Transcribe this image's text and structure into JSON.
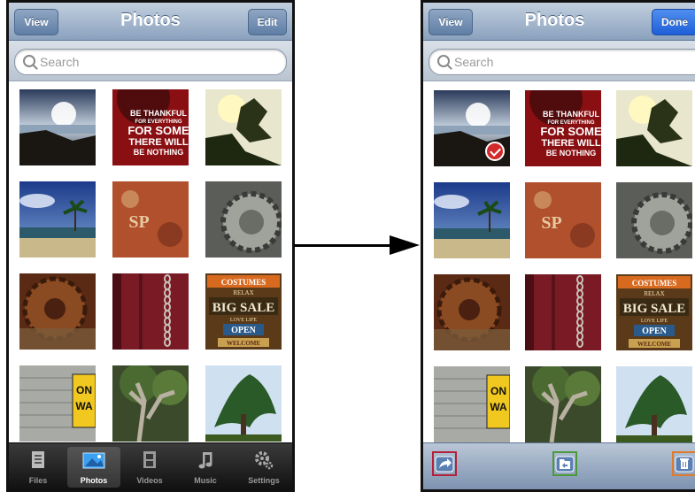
{
  "left_screen": {
    "nav": {
      "title": "Photos",
      "left_button": "View",
      "right_button": "Edit"
    },
    "search": {
      "placeholder": "Search"
    },
    "tabs": [
      {
        "label": "Files",
        "icon": "files-icon"
      },
      {
        "label": "Photos",
        "icon": "photos-icon",
        "active": true
      },
      {
        "label": "Videos",
        "icon": "film-icon"
      },
      {
        "label": "Music",
        "icon": "music-note-icon"
      },
      {
        "label": "Settings",
        "icon": "gear-icon"
      }
    ]
  },
  "right_screen": {
    "nav": {
      "title": "Photos",
      "left_button": "View",
      "right_button": "Done"
    },
    "search": {
      "placeholder": "Search"
    },
    "toolbar": [
      {
        "icon": "share-icon",
        "highlight": "#b3223a"
      },
      {
        "icon": "move-to-folder-icon",
        "highlight": "#4a9a3a"
      },
      {
        "icon": "trash-icon",
        "highlight": "#e07a2a"
      }
    ],
    "selected_photo": "sunset-ocean-photo"
  },
  "photos": [
    "sunset-ocean-photo",
    "be-thankful-poster-photo",
    "tree-silhouette-photo",
    "palm-beach-photo",
    "rusty-sign-photo",
    "gear-wheel-photo",
    "rusty-gear-photo",
    "chain-red-wall-photo",
    "big-sale-signs-photo",
    "brick-wall-sign-photo",
    "twisted-tree-photo",
    "cypress-tree-photo"
  ],
  "poster_text": [
    "BE THANKFUL",
    "FOR EVERYTHING",
    "FOR SOME",
    "THERE WILL",
    "BE NOTHING"
  ],
  "sign_text": {
    "top": "COSTUMES",
    "relax": "RELAX",
    "big": "BIG SALE",
    "love": "LOVE LIFE",
    "open": "OPEN",
    "welcome": "WELCOME"
  },
  "rust_text": "SP",
  "street_sign_text": [
    "ON",
    "WA"
  ]
}
